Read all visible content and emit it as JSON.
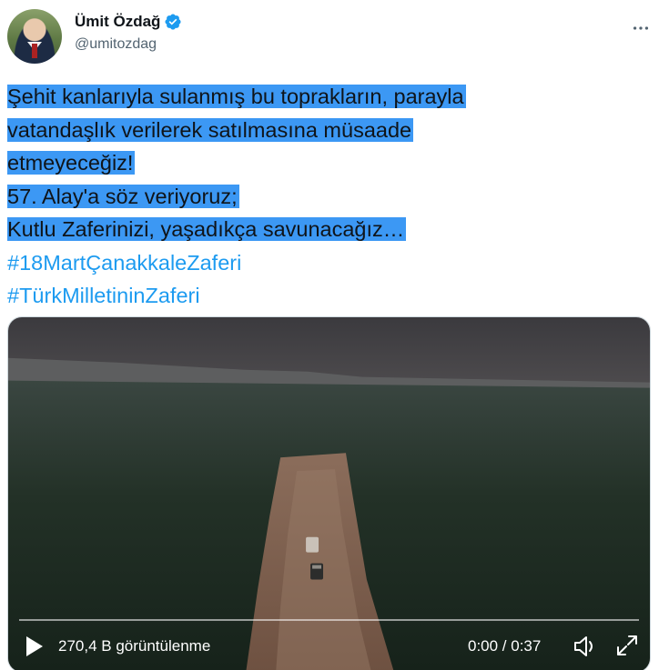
{
  "author": {
    "display_name": "Ümit Özdağ",
    "handle": "@umitozdag",
    "verified": true,
    "avatar_icon": "profile-photo"
  },
  "tweet": {
    "lines": [
      "Şehit kanlarıyla sulanmış bu toprakların, parayla ",
      "vatandaşlık verilerek satılmasına müsaade ",
      "etmeyeceğiz!",
      "57. Alay'a söz veriyoruz;",
      "Kutlu Zaferinizi, yaşadıkça savunacağız…"
    ],
    "hashtags": [
      "#18MartÇanakkaleZaferi",
      "#TürkMilletininZaferi"
    ]
  },
  "video": {
    "views": "270,4 B görüntülenme",
    "time": "0:00 / 0:37",
    "progress": 0,
    "icons": [
      "play-icon",
      "volume-icon",
      "fullscreen-icon"
    ]
  },
  "colors": {
    "selection": "#3c98f4",
    "hashtag": "#1d9bf0",
    "verified": "#1d9bf0"
  }
}
